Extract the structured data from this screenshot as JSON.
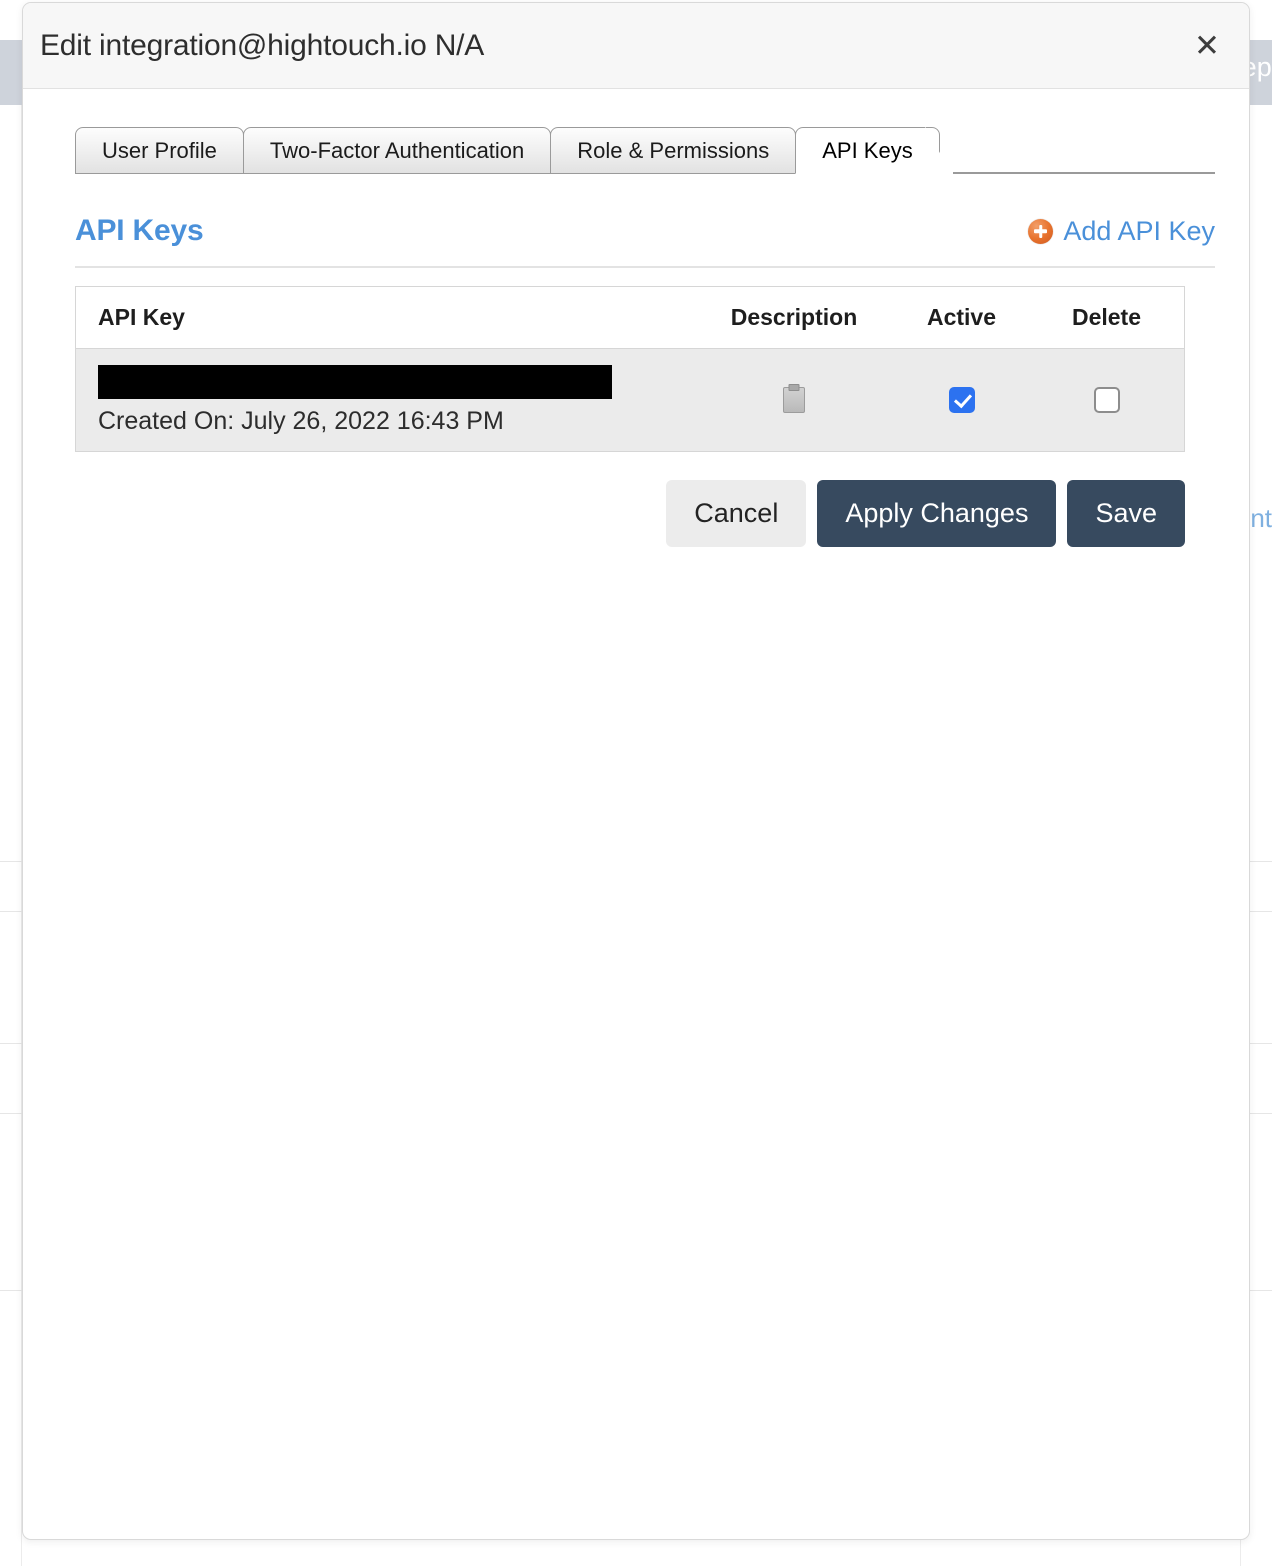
{
  "background": {
    "header_fragment_text": "ep",
    "link_fragment_text": "nt"
  },
  "modal": {
    "title": "Edit integration@hightouch.io N/A",
    "close_icon_label": "✕",
    "tabs": [
      {
        "label": "User Profile",
        "active": false
      },
      {
        "label": "Two-Factor Authentication",
        "active": false
      },
      {
        "label": "Role & Permissions",
        "active": false
      },
      {
        "label": "API Keys",
        "active": true
      }
    ],
    "section": {
      "title": "API Keys",
      "add_link_label": "Add API Key",
      "add_icon": "plus-circle-icon",
      "accent_blue": "#4a90d9",
      "accent_orange": "#e8732e"
    },
    "table": {
      "columns": [
        "API Key",
        "Description",
        "Active",
        "Delete"
      ],
      "rows": [
        {
          "key_redacted": true,
          "created_on": "Created On: July 26, 2022 16:43 PM",
          "description_icon": "note-icon",
          "active_checked": true,
          "delete_checked": false
        }
      ]
    },
    "buttons": {
      "cancel": "Cancel",
      "apply": "Apply Changes",
      "save": "Save",
      "primary_color": "#374a5f",
      "secondary_color": "#ececec"
    }
  }
}
